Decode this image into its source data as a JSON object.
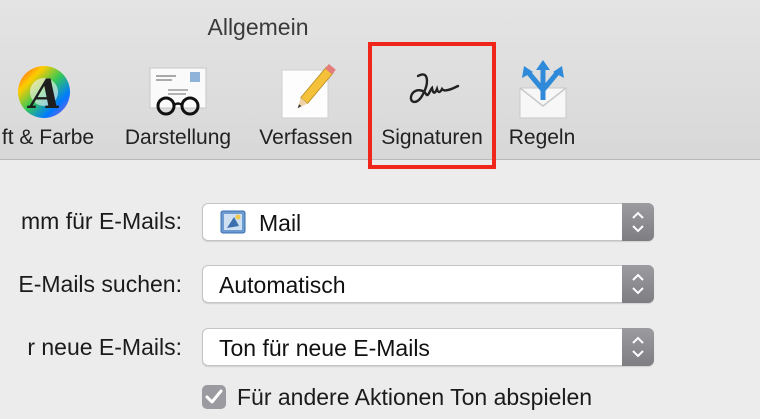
{
  "window": {
    "title": "Allgemein"
  },
  "toolbar": {
    "tabs": [
      {
        "label": "ft & Farbe",
        "icon": "font-color-wheel-icon"
      },
      {
        "label": "Darstellung",
        "icon": "envelope-glasses-icon"
      },
      {
        "label": "Verfassen",
        "icon": "notepad-pencil-icon"
      },
      {
        "label": "Signaturen",
        "icon": "signature-icon",
        "selected": true
      },
      {
        "label": "Regeln",
        "icon": "rules-envelope-arrows-icon"
      }
    ]
  },
  "settings": {
    "rows": [
      {
        "label": "mm für E-Mails:",
        "value": "Mail",
        "icon": "mail-app-icon"
      },
      {
        "label": "E-Mails suchen:",
        "value": "Automatisch"
      },
      {
        "label": "r neue E-Mails:",
        "value": "Ton für neue E-Mails"
      }
    ],
    "checkbox": {
      "label": "Für andere Aktionen Ton abspielen",
      "checked": true
    }
  },
  "colors": {
    "highlight": "#f0261b",
    "stepper": "#8a8a8f"
  }
}
